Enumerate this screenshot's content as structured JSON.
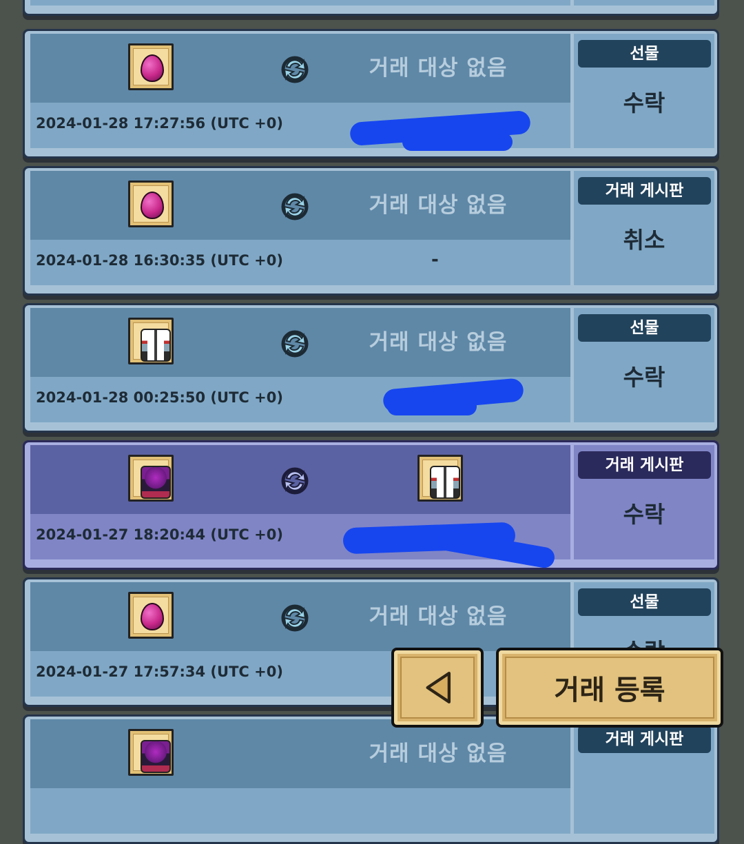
{
  "trades": [
    {
      "left_item": "pink-egg",
      "right_item": null,
      "target": "거래 대상 없음",
      "timestamp": "2024-01-28 17:27:56 (UTC +0)",
      "partner": "",
      "badge": "선물",
      "status": "수락"
    },
    {
      "left_item": "pink-egg",
      "right_item": null,
      "target": "거래 대상 없음",
      "timestamp": "2024-01-28 16:30:35 (UTC +0)",
      "partner": "-",
      "badge": "거래 게시판",
      "status": "취소"
    },
    {
      "left_item": "white-character",
      "right_item": null,
      "target": "거래 대상 없음",
      "timestamp": "2024-01-28 00:25:50 (UTC +0)",
      "partner": "",
      "badge": "선물",
      "status": "수락"
    },
    {
      "left_item": "purple-character",
      "right_item": "white-character",
      "target": "",
      "timestamp": "2024-01-27 18:20:44 (UTC +0)",
      "partner": "",
      "badge": "거래 게시판",
      "status": "수락",
      "highlighted": true
    },
    {
      "left_item": "pink-egg",
      "right_item": null,
      "target": "거래 대상 없음",
      "timestamp": "2024-01-27 17:57:34 (UTC +0)",
      "partner": "",
      "badge": "선물",
      "status": "수락"
    },
    {
      "left_item": "purple-character",
      "right_item": null,
      "target": "거래 대상 없음",
      "timestamp": "",
      "partner": "",
      "badge": "거래 게시판",
      "status": ""
    }
  ],
  "buttons": {
    "back_icon": "left-triangle-icon",
    "register_label": "거래 등록"
  },
  "colors": {
    "card_top": "#5f88a7",
    "card_bottom": "#80a8c6",
    "highlight_top": "#5b62a3",
    "badge_bg": "#22435c",
    "button_gold": "#e2c27e",
    "redaction": "#1746ef"
  }
}
